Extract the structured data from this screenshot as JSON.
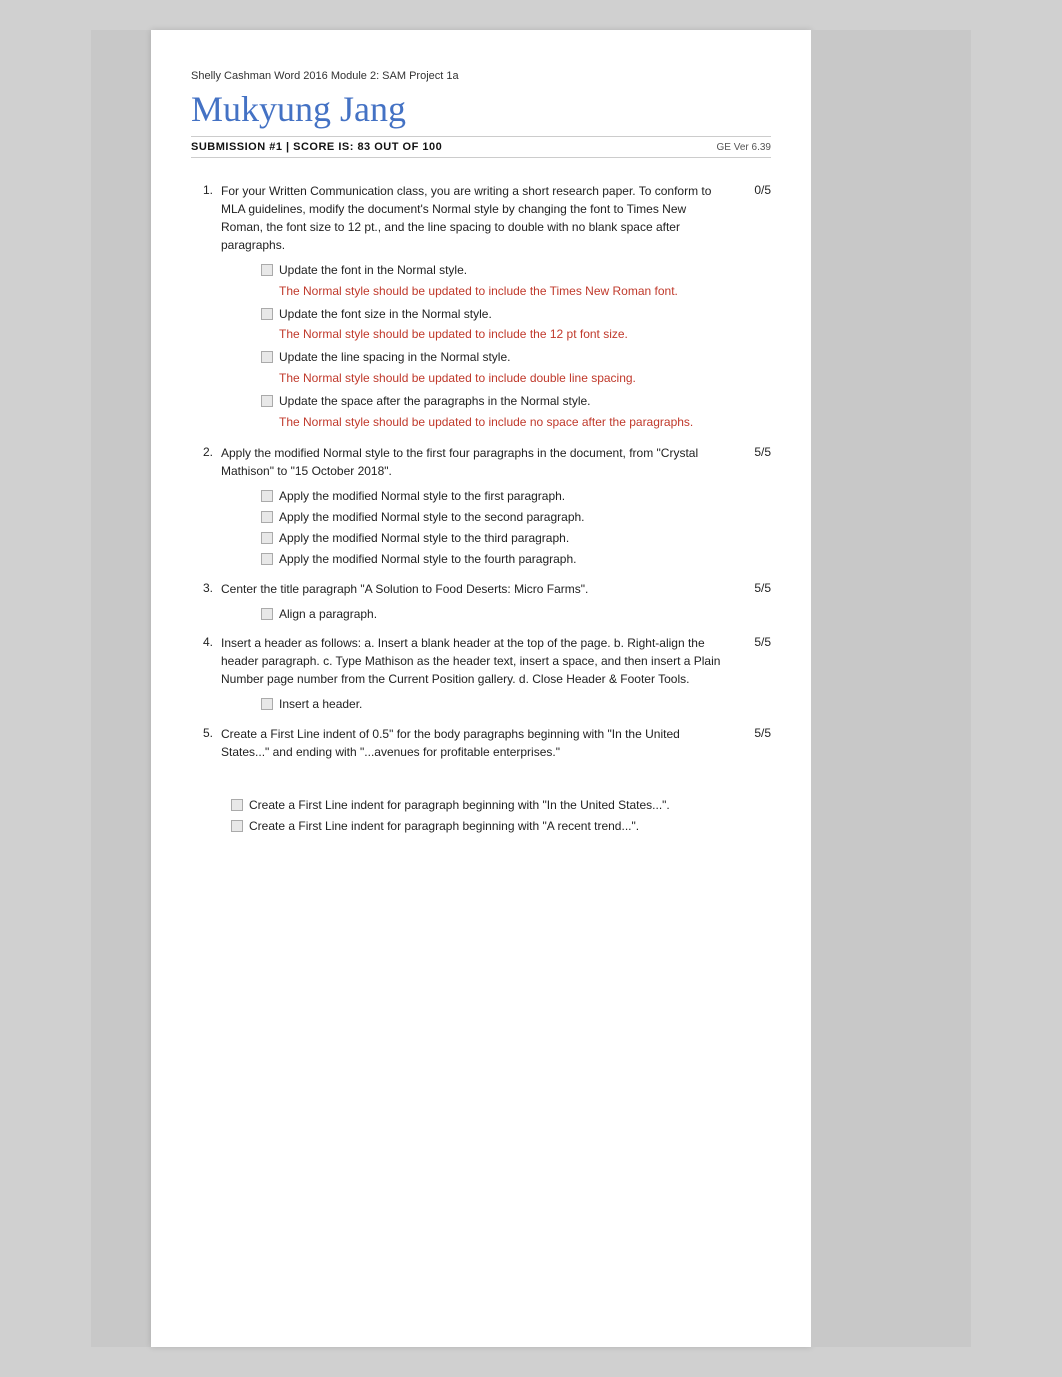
{
  "header": {
    "subtitle": "Shelly Cashman Word 2016 Module 2: SAM Project 1a",
    "title": "Mukyung Jang",
    "submission": "SUBMISSION #1 | SCORE IS:   83  OUT OF 100",
    "version": "GE Ver 6.39"
  },
  "questions": [
    {
      "number": "1.",
      "text": "For your Written Communication class, you are writing a short research paper. To conform to MLA guidelines, modify the document's Normal style by changing the font to Times New Roman, the font size to 12 pt., and the line spacing to double with no blank space after paragraphs.",
      "score": "0/5",
      "items": [
        {
          "label": "Update the font in the Normal style.",
          "feedback": "The Normal style should be updated to include the Times New Roman font."
        },
        {
          "label": "Update the font size in the Normal style.",
          "feedback": "The Normal style should be updated to include the 12 pt font size."
        },
        {
          "label": "Update the line spacing in the Normal style.",
          "feedback": "The Normal style should be updated to include double line spacing."
        },
        {
          "label": "Update the space after the paragraphs in the Normal style.",
          "feedback": "The Normal style should be updated to include no space after the paragraphs."
        }
      ]
    },
    {
      "number": "2.",
      "text": "Apply the modified Normal style to the first four paragraphs in the document, from \"Crystal Mathison\" to \"15 October 2018\".",
      "score": "5/5",
      "items": [
        {
          "label": "Apply the modified Normal style to the first paragraph.",
          "feedback": null
        },
        {
          "label": "Apply the modified Normal style to the second paragraph.",
          "feedback": null
        },
        {
          "label": "Apply the modified Normal style to the third paragraph.",
          "feedback": null
        },
        {
          "label": "Apply the modified Normal style to the fourth paragraph.",
          "feedback": null
        }
      ]
    },
    {
      "number": "3.",
      "text": "Center the title paragraph \"A Solution to Food Deserts: Micro Farms\".",
      "score": "5/5",
      "items": [
        {
          "label": "Align a paragraph.",
          "feedback": null
        }
      ]
    },
    {
      "number": "4.",
      "text": "Insert a header as follows: a. Insert a blank header at the top of the page. b. Right-align the header paragraph. c. Type Mathison as the header text, insert a space, and then insert a Plain Number page number from the Current Position gallery. d. Close Header & Footer Tools.",
      "score": "5/5",
      "items": [
        {
          "label": "Insert a header.",
          "feedback": null
        }
      ]
    },
    {
      "number": "5.",
      "text": "Create a First Line indent of 0.5\" for the body paragraphs beginning with \"In the United States...\" and ending with \"...avenues for profitable enterprises.\"",
      "score": "5/5",
      "items": []
    }
  ],
  "bottom_items": [
    {
      "label": "Create a First Line indent for paragraph beginning with \"In the United States...\".",
      "feedback": null
    },
    {
      "label": "Create a First Line indent for paragraph beginning with \"A recent trend...\".",
      "feedback": null
    }
  ]
}
